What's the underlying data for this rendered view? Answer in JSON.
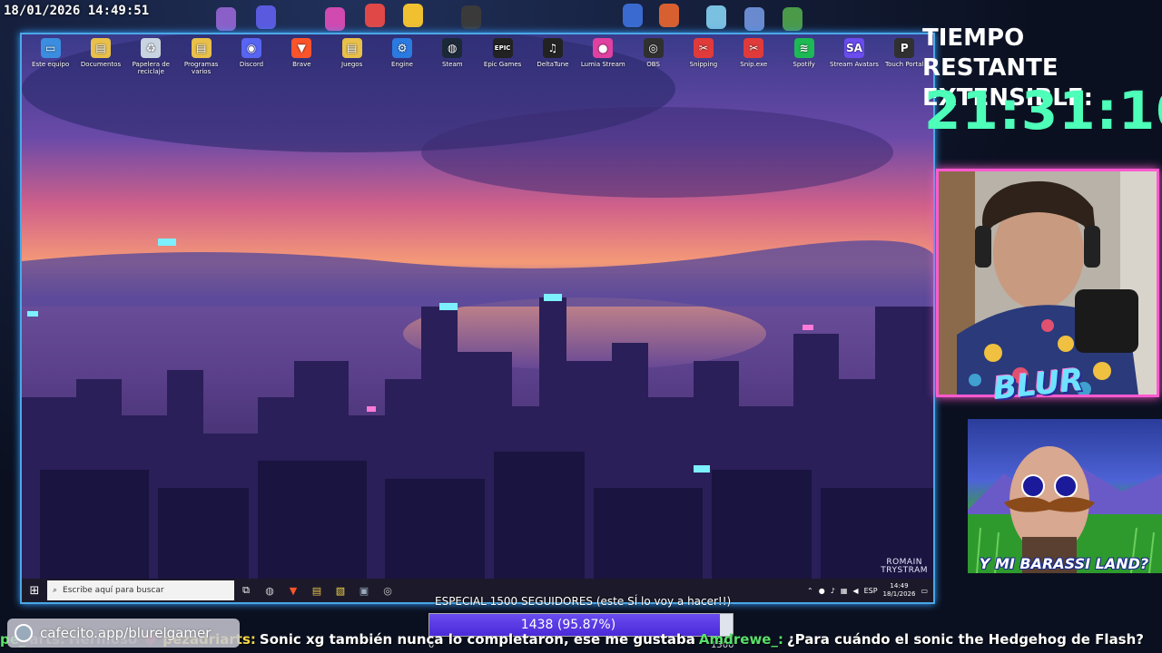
{
  "timestamp": "18/01/2026 14:49:51",
  "desktop": {
    "icons": [
      {
        "label": "Este equipo",
        "icon": "computer-icon",
        "color": "#3b8de0",
        "glyph": "▭"
      },
      {
        "label": "Documentos",
        "icon": "folder-icon",
        "color": "#e8c04a",
        "glyph": "▤"
      },
      {
        "label": "Papelera de reciclaje",
        "icon": "recycle-bin-icon",
        "color": "#c8d4e0",
        "glyph": "♻"
      },
      {
        "label": "Programas varios",
        "icon": "folder-icon",
        "color": "#e8c04a",
        "glyph": "▤"
      },
      {
        "label": "Discord",
        "icon": "discord-icon",
        "color": "#5865f2",
        "glyph": "◉"
      },
      {
        "label": "Brave",
        "icon": "brave-icon",
        "color": "#fb542b",
        "glyph": "▼"
      },
      {
        "label": "Juegos",
        "icon": "folder-icon",
        "color": "#e8c04a",
        "glyph": "▤"
      },
      {
        "label": "Engine",
        "icon": "engine-icon",
        "color": "#2a7ae0",
        "glyph": "⚙"
      },
      {
        "label": "Steam",
        "icon": "steam-icon",
        "color": "#1b2838",
        "glyph": "◍"
      },
      {
        "label": "Epic Games",
        "icon": "epic-games-icon",
        "color": "#222222",
        "glyph": "EPIC"
      },
      {
        "label": "DeltaTune",
        "icon": "music-icon",
        "color": "#222222",
        "glyph": "♫"
      },
      {
        "label": "Lumia Stream",
        "icon": "lumia-icon",
        "color": "#e040a0",
        "glyph": "●"
      },
      {
        "label": "OBS",
        "icon": "obs-icon",
        "color": "#303030",
        "glyph": "◎"
      },
      {
        "label": "Snipping",
        "icon": "snip-icon",
        "color": "#e03a3a",
        "glyph": "✂"
      },
      {
        "label": "Snip.exe",
        "icon": "snip-exe-icon",
        "color": "#e03a3a",
        "glyph": "✂"
      },
      {
        "label": "Spotify",
        "icon": "spotify-icon",
        "color": "#1db954",
        "glyph": "≋"
      },
      {
        "label": "Stream Avatars",
        "icon": "stream-avatars-icon",
        "color": "#6a4cf0",
        "glyph": "SA"
      },
      {
        "label": "Touch Portal",
        "icon": "touch-portal-icon",
        "color": "#303030",
        "glyph": "P"
      }
    ],
    "signature": [
      "ROMAIN",
      "TRYSTRAM"
    ]
  },
  "taskbar": {
    "search_placeholder": "Escribe aquí para buscar",
    "language": "ESP",
    "time": "14:49",
    "date": "18/1/2026"
  },
  "timer": {
    "label_line1": "TIEMPO RESTANTE",
    "label_line2": "EXTENSIBLE:",
    "value": "21:31:10",
    "color": "#4dffb8"
  },
  "overlay": {
    "logo": "BLUR",
    "barassi_caption": "Y MI BARASSI LAND?"
  },
  "goal": {
    "title": "ESPECIAL 1500 SEGUIDORES (este SÍ lo voy a hacer!!)",
    "progress_text": "1438 (95.87%)",
    "progress_fraction": 0.9587,
    "min": "0",
    "max": "1500"
  },
  "cafecito": "cafecito.app/blurelgamer",
  "ticker": [
    {
      "user": "pe_",
      "message": "",
      "user_color": "#59e06a"
    },
    {
      "user": "arts:",
      "message": "Hermoso 💗",
      "user_color": "faded"
    },
    {
      "user": "pezadriarts:",
      "message": "Sonic xg también nunca lo completaron, ese me gustaba",
      "user_color": "#f5d94a"
    },
    {
      "user": "Amdrewe_:",
      "message": "¿Para cuándo el sonic the Hedgehog de Flash?",
      "user_color": "#59e06a"
    }
  ]
}
